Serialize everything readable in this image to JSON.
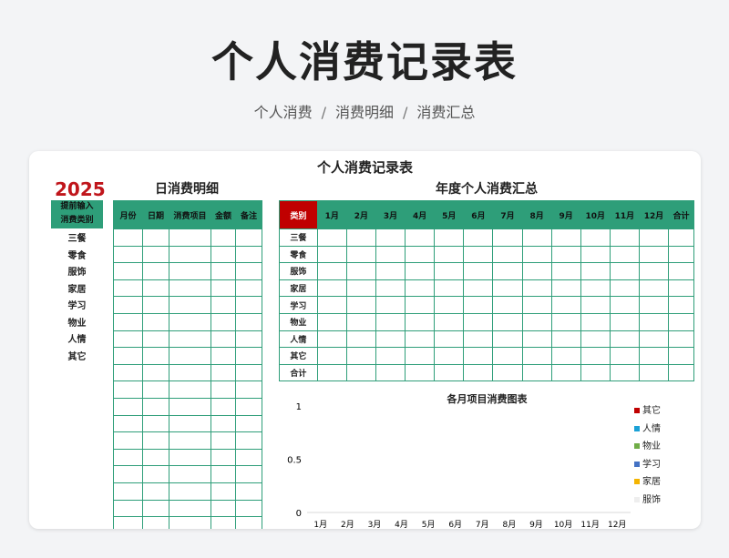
{
  "page": {
    "title": "个人消费记录表",
    "nav": [
      "个人消费",
      "消费明细",
      "消费汇总"
    ],
    "nav_sep": "/"
  },
  "sheet": {
    "title": "个人消费记录表",
    "year": "2025",
    "category_header": [
      "提前输入",
      "消费类别"
    ],
    "categories": [
      "三餐",
      "零食",
      "服饰",
      "家居",
      "学习",
      "物业",
      "人情",
      "其它"
    ],
    "daily_title": "日消费明细",
    "daily_columns": [
      "月份",
      "日期",
      "消费项目",
      "金额",
      "备注"
    ],
    "annual_title": "年度个人消费汇总",
    "annual_columns": [
      "类别",
      "1月",
      "2月",
      "3月",
      "4月",
      "5月",
      "6月",
      "7月",
      "8月",
      "9月",
      "10月",
      "11月",
      "12月",
      "合计"
    ],
    "annual_rows": [
      "三餐",
      "零食",
      "服饰",
      "家居",
      "学习",
      "物业",
      "人情",
      "其它",
      "合计"
    ]
  },
  "chart_data": {
    "type": "bar",
    "title": "各月项目消费图表",
    "categories": [
      "1月",
      "2月",
      "3月",
      "4月",
      "5月",
      "6月",
      "7月",
      "8月",
      "9月",
      "10月",
      "11月",
      "12月"
    ],
    "ylim": [
      0,
      1
    ],
    "yticks": [
      "1",
      "0.5",
      "0"
    ],
    "series": [
      {
        "name": "其它",
        "color": "#c00000",
        "values": [
          0,
          0,
          0,
          0,
          0,
          0,
          0,
          0,
          0,
          0,
          0,
          0
        ]
      },
      {
        "name": "人情",
        "color": "#1ba1d6",
        "values": [
          0,
          0,
          0,
          0,
          0,
          0,
          0,
          0,
          0,
          0,
          0,
          0
        ]
      },
      {
        "name": "物业",
        "color": "#70ad47",
        "values": [
          0,
          0,
          0,
          0,
          0,
          0,
          0,
          0,
          0,
          0,
          0,
          0
        ]
      },
      {
        "name": "学习",
        "color": "#4472c4",
        "values": [
          0,
          0,
          0,
          0,
          0,
          0,
          0,
          0,
          0,
          0,
          0,
          0
        ]
      },
      {
        "name": "家居",
        "color": "#f4b400",
        "values": [
          0,
          0,
          0,
          0,
          0,
          0,
          0,
          0,
          0,
          0,
          0,
          0
        ]
      },
      {
        "name": "服饰",
        "color": "#eeeeee",
        "values": [
          0,
          0,
          0,
          0,
          0,
          0,
          0,
          0,
          0,
          0,
          0,
          0
        ]
      }
    ]
  }
}
